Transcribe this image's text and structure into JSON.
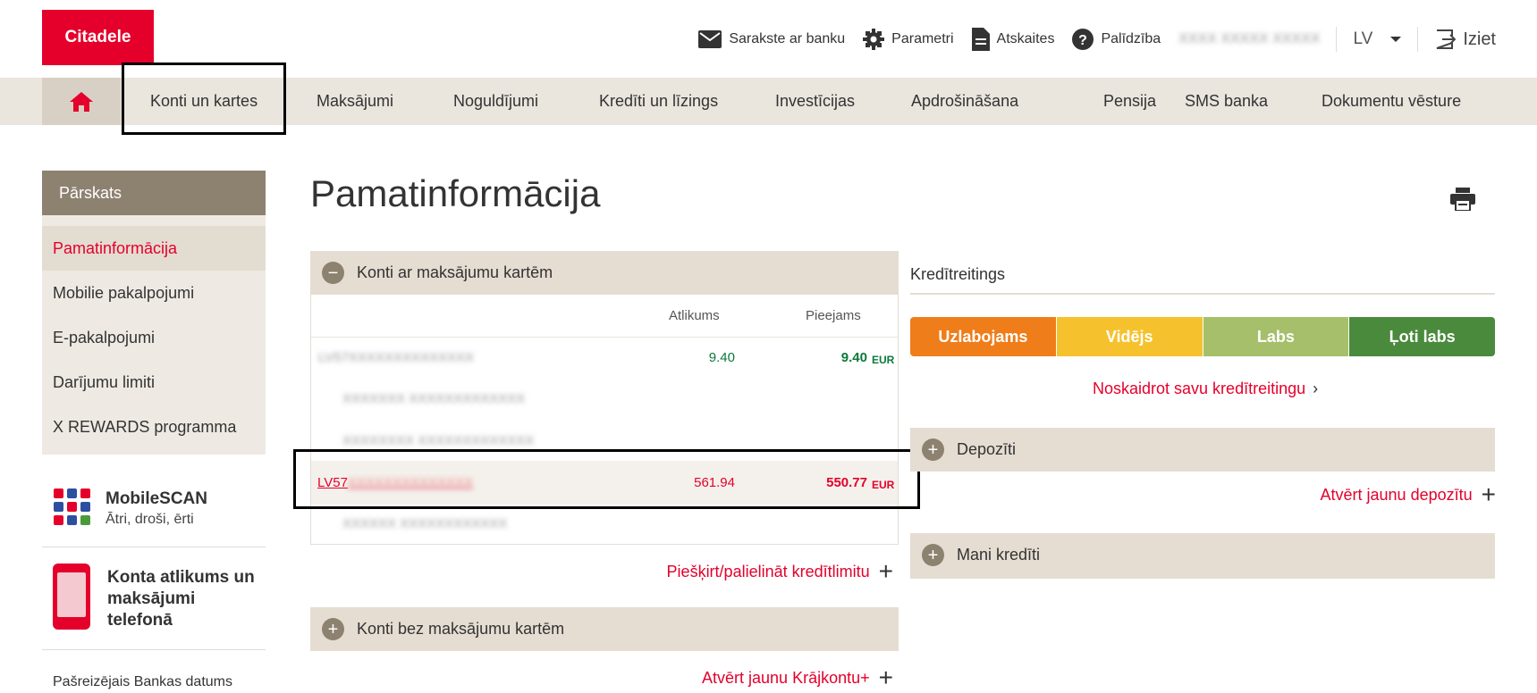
{
  "header": {
    "logo": "Citadele",
    "topbar": {
      "correspondence": "Sarakste ar banku",
      "settings": "Parametri",
      "reports": "Atskaites",
      "help": "Palīdzība",
      "user_name": "XXXX XXXXX XXXXX",
      "language": "LV",
      "logout": "Iziet"
    }
  },
  "nav": {
    "items": [
      "Konti un kartes",
      "Maksājumi",
      "Noguldījumi",
      "Kredīti un līzings",
      "Investīcijas",
      "Apdrošināšana",
      "Pensija",
      "SMS banka",
      "Dokumentu vēsture"
    ],
    "active_index": 0
  },
  "sidebar": {
    "heading": "Pārskats",
    "items": [
      "Pamatinformācija",
      "Mobilie pakalpojumi",
      "E-pakalpojumi",
      "Darījumu limiti",
      "X REWARDS programma"
    ],
    "active_index": 0,
    "mobilescan": {
      "title": "MobileSCAN",
      "subtitle": "Ātri, droši, ērti"
    },
    "phone_promo": "Konta atlikums un maksājumi telefonā",
    "bank_date_label": "Pašreizējais Bankas datums"
  },
  "main": {
    "title": "Pamatinformācija",
    "accounts_with_cards": {
      "heading": "Konti ar maksājumu kartēm",
      "col_balance": "Atlikums",
      "col_available": "Pieejams",
      "rows": [
        {
          "account": "LV57XXXXXXXXXXXXXX",
          "balance": "9.40",
          "available": "9.40",
          "currency": "EUR"
        },
        {
          "card": "XXXXXXX XXXXXXXXXXXXX"
        },
        {
          "card": "XXXXXXXX XXXXXXXXXXXXX"
        },
        {
          "account_prefix": "LV57",
          "account_hidden": "XXXXXXXXXXXXXX",
          "balance": "561.94",
          "available": "550.77",
          "currency": "EUR"
        },
        {
          "card": "XXXXXX XXXXXXXXXXXX"
        }
      ],
      "credit_limit_link": "Piešķirt/palielināt kredītlimitu"
    },
    "accounts_without_cards": {
      "heading": "Konti bez maksājumu kartēm",
      "open_savings_link": "Atvērt jaunu Krājkontu+"
    }
  },
  "right": {
    "credit_rating_title": "Kredītreitings",
    "ratings": [
      {
        "label": "Uzlabojams",
        "color": "#ef7d1a"
      },
      {
        "label": "Vidējs",
        "color": "#f5c22e"
      },
      {
        "label": "Labs",
        "color": "#a5bf6a"
      },
      {
        "label": "Ļoti labs",
        "color": "#4a8a3c"
      }
    ],
    "check_rating_link": "Noskaidrot savu kredītreitingu",
    "deposits": {
      "heading": "Depozīti",
      "open_link": "Atvērt jaunu depozītu"
    },
    "my_loans": {
      "heading": "Mani kredīti"
    }
  },
  "colors": {
    "brand": "#e4002b",
    "panel": "#e5ddd2",
    "sidebar_head": "#8d8170",
    "positive": "#0a7a3a"
  }
}
